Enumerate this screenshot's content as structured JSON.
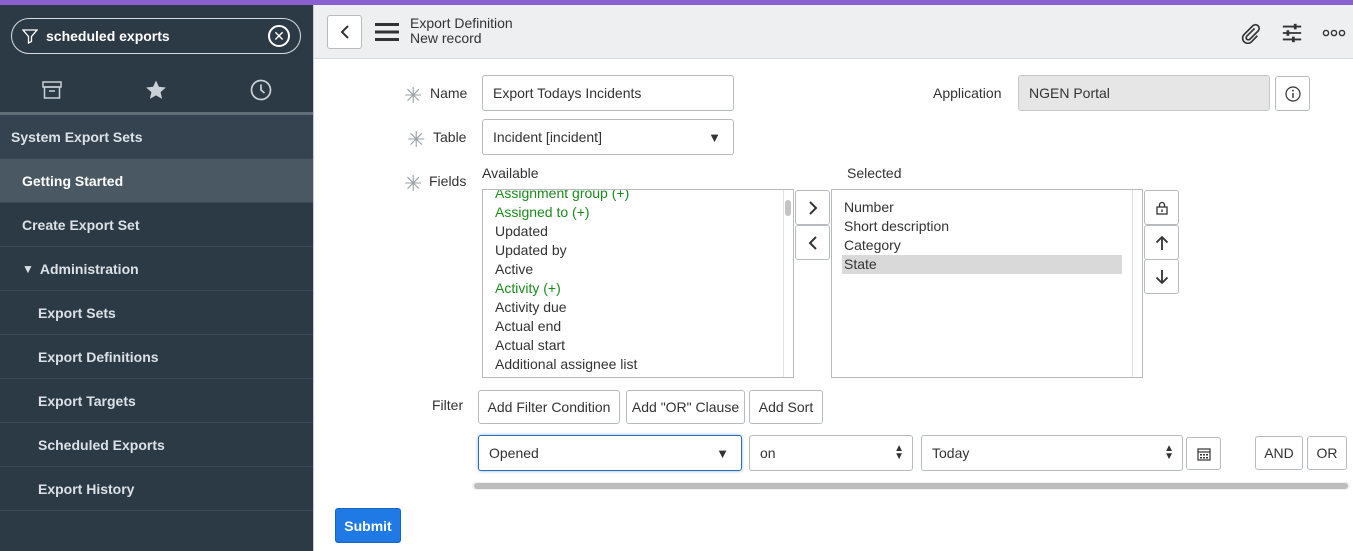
{
  "sidebar": {
    "search": {
      "value": "scheduled exports"
    },
    "tabs": [
      "archive-icon",
      "star-icon",
      "clock-icon"
    ],
    "items": [
      {
        "label": "System Export Sets"
      },
      {
        "label": "Getting Started"
      },
      {
        "label": "Create Export Set"
      },
      {
        "label": "Administration"
      },
      {
        "label": "Export Sets"
      },
      {
        "label": "Export Definitions"
      },
      {
        "label": "Export Targets"
      },
      {
        "label": "Scheduled Exports"
      },
      {
        "label": "Export History"
      }
    ]
  },
  "header": {
    "title": "Export Definition",
    "subtitle": "New record"
  },
  "form": {
    "name_label": "Name",
    "name_value": "Export Todays Incidents",
    "application_label": "Application",
    "application_value": "NGEN Portal",
    "table_label": "Table",
    "table_value": "Incident [incident]",
    "fields_label": "Fields",
    "available_label": "Available",
    "selected_label": "Selected",
    "available": [
      {
        "text": "Assignment group (+)",
        "green": true
      },
      {
        "text": "Assigned to (+)",
        "green": true
      },
      {
        "text": "Updated",
        "green": false
      },
      {
        "text": "Updated by",
        "green": false
      },
      {
        "text": "Active",
        "green": false
      },
      {
        "text": "Activity (+)",
        "green": true
      },
      {
        "text": "Activity due",
        "green": false
      },
      {
        "text": "Actual end",
        "green": false
      },
      {
        "text": "Actual start",
        "green": false
      },
      {
        "text": "Additional assignee list",
        "green": false
      }
    ],
    "selected": [
      "Number",
      "Short description",
      "Category",
      "State"
    ],
    "filter_label": "Filter",
    "filter_buttons": {
      "add_condition": "Add Filter Condition",
      "add_or": "Add \"OR\" Clause",
      "add_sort": "Add Sort"
    },
    "condition": {
      "field": "Opened",
      "operator": "on",
      "value": "Today"
    },
    "and_label": "AND",
    "or_label": "OR",
    "submit_label": "Submit"
  },
  "colors": {
    "accent": "#8a5fd1",
    "sidebar": "#2c3a45",
    "submit": "#1f7ae5",
    "green_field": "#1c8a1c"
  }
}
